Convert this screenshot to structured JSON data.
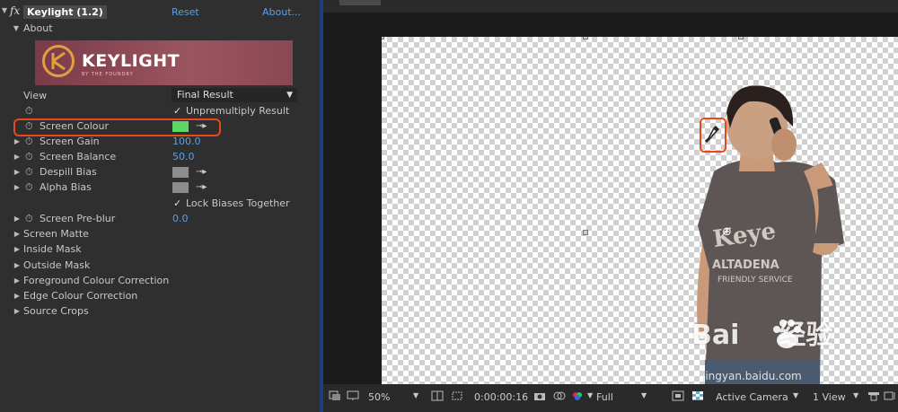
{
  "effect": {
    "fx_label": "fx",
    "name": "Keylight (1.2)",
    "reset": "Reset",
    "about": "About..."
  },
  "about_section": {
    "label": "About",
    "banner_text": "KEYLIGHT",
    "banner_sub": "BY THE FOUNDRY"
  },
  "view": {
    "label": "View",
    "value": "Final Result"
  },
  "unpremultiply": {
    "label": "Unpremultiply Result",
    "checked": true
  },
  "params": {
    "screen_colour": {
      "label": "Screen Colour",
      "color": "#5cd665"
    },
    "screen_gain": {
      "label": "Screen Gain",
      "value": "100.0"
    },
    "screen_balance": {
      "label": "Screen Balance",
      "value": "50.0"
    },
    "despill_bias": {
      "label": "Despill Bias",
      "color": "#8c8c8c"
    },
    "alpha_bias": {
      "label": "Alpha Bias",
      "color": "#8c8c8c"
    },
    "lock_biases": {
      "label": "Lock Biases Together",
      "checked": true
    },
    "screen_preblur": {
      "label": "Screen Pre-blur",
      "value": "0.0"
    }
  },
  "groups": [
    "Screen Matte",
    "Inside Mask",
    "Outside Mask",
    "Foreground Colour Correction",
    "Edge Colour Correction",
    "Source Crops"
  ],
  "viewer_toolbar": {
    "zoom": "50%",
    "timecode": "0:00:00:16",
    "resolution": "Full",
    "camera": "Active Camera",
    "views": "1 View"
  },
  "watermark": {
    "brand": "Bai",
    "brand2": "经验",
    "site": "jingyan.baidu.com"
  },
  "colors": {
    "highlight": "#e8491c",
    "link_blue": "#5aa0e6",
    "panel_bg": "#2f2f2f"
  }
}
